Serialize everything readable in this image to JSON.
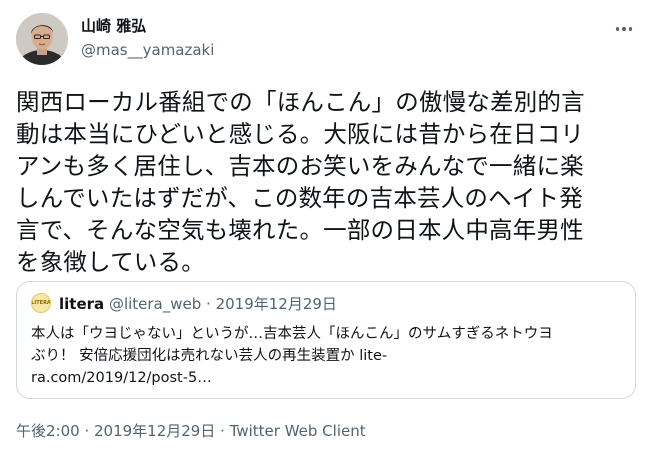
{
  "author": {
    "name": "山崎 雅弘",
    "handle": "@mas__yamazaki",
    "avatar": "author-portrait"
  },
  "tweet": {
    "text": "関西ローカル番組での「ほんこん」の傲慢な差別的言\n動は本当にひどいと感じる。大阪には昔から在日コリ\nアンも多く居住し、吉本のお笑いをみんなで一緒に楽\nしんでいたはずだが、この数年の吉本芸人のヘイト発\n言で、そんな空気も壊れた。一部の日本人中高年男性\nを象徴している。"
  },
  "quote": {
    "avatar_label": "LITERA",
    "name": "litera",
    "handle": "@litera_web",
    "separator": " · ",
    "date": "2019年12月29日",
    "text": "本人は「ウヨじゃない」というが…吉本芸人「ほんこん」のサムすぎるネトウヨ\nぶり！ 安倍応援団化は売れない芸人の再生装置か lite-\nra.com/2019/12/post-5…"
  },
  "footer": {
    "time": "午後2:00",
    "date": "2019年12月29日",
    "client": "Twitter Web Client",
    "separator": " · "
  },
  "icons": {
    "more": "more-horizontal-icon"
  },
  "colors": {
    "text": "#0f1419",
    "secondary": "#536471",
    "border": "#cfd9de"
  }
}
